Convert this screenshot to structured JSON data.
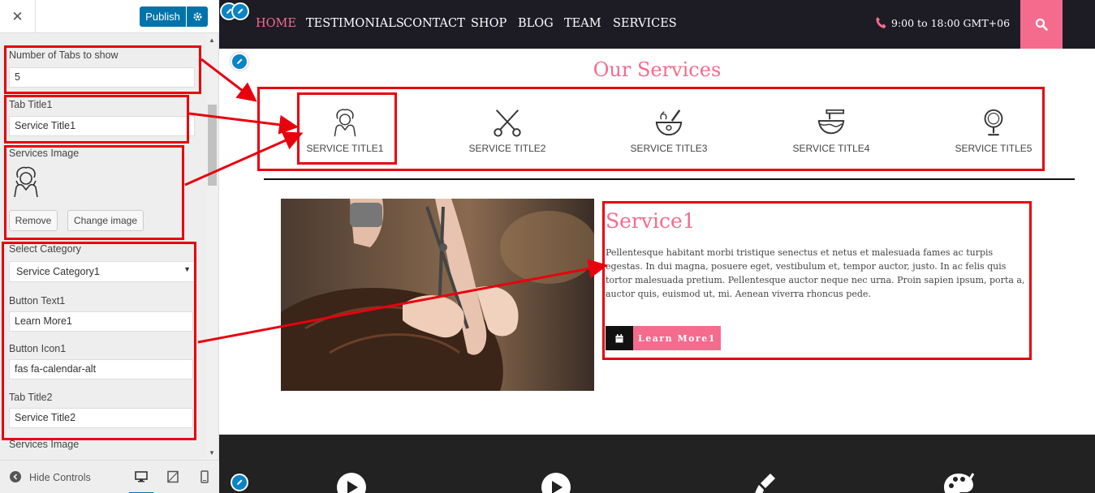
{
  "sidebar": {
    "close_icon": "close-icon",
    "publish_label": "Publish",
    "settings_icon": "gear-icon",
    "num_tabs_label": "Number of Tabs to show",
    "num_tabs_value": "5",
    "tab_title1_label": "Tab Title1",
    "tab_title1_value": "Service Title1",
    "services_image_label": "Services Image",
    "remove_label": "Remove",
    "change_image_label": "Change image",
    "select_category_label": "Select Category",
    "select_category_value": "Service Category1",
    "button_text1_label": "Button Text1",
    "button_text1_value": "Learn More1",
    "button_icon1_label": "Button Icon1",
    "button_icon1_value": "fas fa-calendar-alt",
    "tab_title2_label": "Tab Title2",
    "tab_title2_value": "Service Title2",
    "services_image2_label": "Services Image",
    "hide_controls_label": "Hide Controls"
  },
  "nav": {
    "items": [
      "HOME",
      "TESTIMONIALS",
      "CONTACT",
      "SHOP",
      "BLOG",
      "TEAM",
      "SERVICES"
    ],
    "active_index": 0,
    "hours": "9:00 to 18:00 GMT+06"
  },
  "services": {
    "section_title": "Our Services",
    "tabs": [
      "SERVICE TITLE1",
      "SERVICE TITLE2",
      "SERVICE TITLE3",
      "SERVICE TITLE4",
      "SERVICE TITLE5"
    ],
    "active_title": "Service1",
    "description": "Pellentesque habitant morbi tristique senectus et netus et malesuada fames ac turpis egestas. In dui magna, posuere eget, vestibulum et, tempor auctor, justo. In ac felis quis tortor malesuada pretium. Pellentesque auctor neque nec urna. Proin sapien ipsum, porta a, auctor quis, euismod ut, mi. Aenean viverra rhoncus pede.",
    "button_label": "Learn More1",
    "button_icon": "calendar-icon"
  },
  "colors": {
    "accent": "#f56b8e",
    "nav_bg": "#1d1c25",
    "wp_blue": "#0073aa",
    "annotation_red": "#e8000d"
  }
}
